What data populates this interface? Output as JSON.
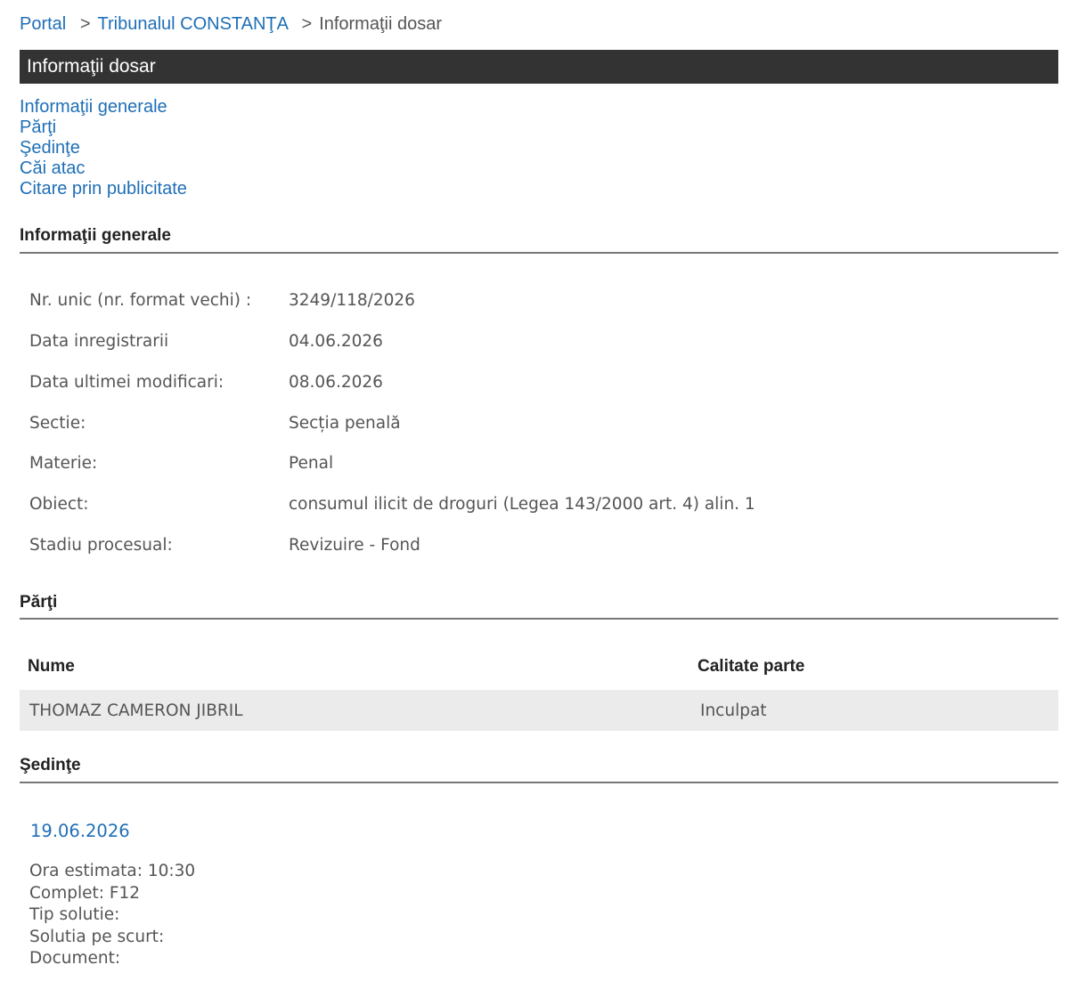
{
  "breadcrumb": {
    "portal": "Portal",
    "tribunal": "Tribunalul CONSTANŢA",
    "current": "Informaţii dosar",
    "separator": ">"
  },
  "title_bar": "Informaţii dosar",
  "nav_links": [
    "Informaţii generale",
    "Părţi",
    "Şedinţe",
    "Căi atac",
    "Citare prin publicitate"
  ],
  "general": {
    "heading": "Informaţii generale",
    "rows": [
      {
        "label": "Nr. unic (nr. format vechi) :",
        "value": "3249/118/2026"
      },
      {
        "label": "Data inregistrarii",
        "value": "04.06.2026"
      },
      {
        "label": "Data ultimei modificari:",
        "value": "08.06.2026"
      },
      {
        "label": "Sectie:",
        "value": "Secția penală"
      },
      {
        "label": "Materie:",
        "value": "Penal"
      },
      {
        "label": "Obiect:",
        "value": "consumul ilicit de droguri (Legea 143/2000 art. 4) alin. 1"
      },
      {
        "label": "Stadiu procesual:",
        "value": "Revizuire - Fond"
      }
    ]
  },
  "parties": {
    "heading": "Părţi",
    "columns": [
      "Nume",
      "Calitate parte"
    ],
    "rows": [
      {
        "name": "THOMAZ CAMERON JIBRIL",
        "role": "Inculpat"
      }
    ]
  },
  "sessions": {
    "heading": "Şedinţe",
    "date": "19.06.2026",
    "lines": [
      "Ora estimata: 10:30",
      "Complet: F12",
      "Tip solutie:",
      "Solutia pe scurt:",
      "Document:"
    ]
  },
  "colors": {
    "link": "#1f6fb6",
    "title_bar_bg": "#333333",
    "row_bg": "#ebebeb"
  }
}
